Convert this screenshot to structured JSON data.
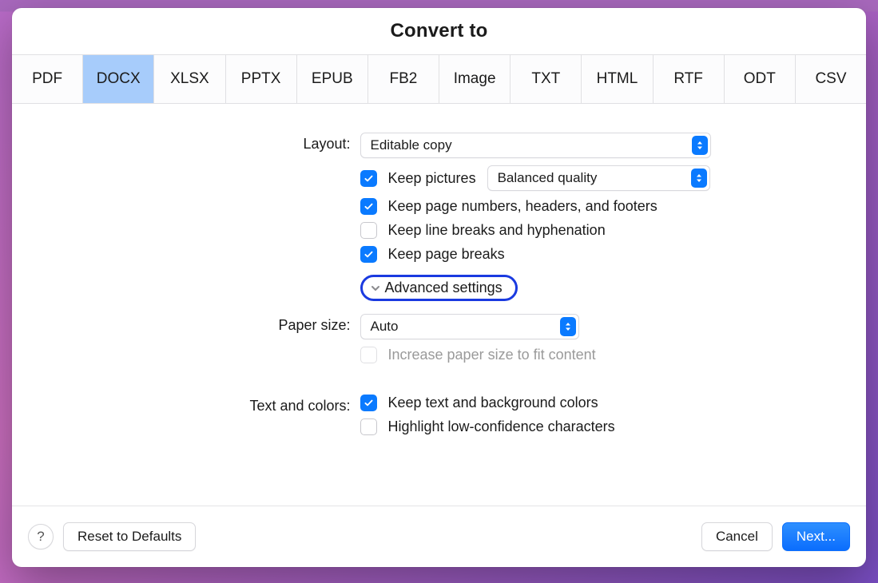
{
  "title": "Convert to",
  "tabs": {
    "items": [
      "PDF",
      "DOCX",
      "XLSX",
      "PPTX",
      "EPUB",
      "FB2",
      "Image",
      "TXT",
      "HTML",
      "RTF",
      "ODT",
      "CSV"
    ],
    "active_index": 1
  },
  "layout": {
    "label": "Layout:",
    "select_value": "Editable copy",
    "keep_pictures": {
      "checked": true,
      "label": "Keep pictures",
      "quality": "Balanced quality"
    },
    "keep_headers": {
      "checked": true,
      "label": "Keep page numbers, headers, and footers"
    },
    "keep_linebreaks": {
      "checked": false,
      "label": "Keep line breaks and hyphenation"
    },
    "keep_pagebreaks": {
      "checked": true,
      "label": "Keep page breaks"
    }
  },
  "advanced_label": "Advanced settings",
  "paper_size": {
    "label": "Paper size:",
    "value": "Auto",
    "increase": {
      "checked": false,
      "disabled": true,
      "label": "Increase paper size to fit content"
    }
  },
  "text_colors": {
    "label": "Text and colors:",
    "keep_colors": {
      "checked": true,
      "label": "Keep text and background colors"
    },
    "highlight_low": {
      "checked": false,
      "label": "Highlight low-confidence characters"
    }
  },
  "footer": {
    "help": "?",
    "reset": "Reset to Defaults",
    "cancel": "Cancel",
    "next": "Next..."
  }
}
